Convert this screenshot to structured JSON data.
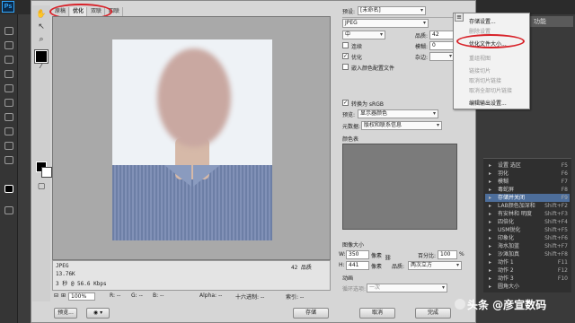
{
  "app": {
    "logo_text": "Ps",
    "panel_title": "功能"
  },
  "dialog": {
    "tabs": [
      "原稿",
      "优化",
      "双联",
      "四联"
    ],
    "active_tab": 1,
    "preset_label": "预设:",
    "preset_value": "[未命名]",
    "format_value": "JPEG",
    "compression_value": "中",
    "quality_label": "品质:",
    "quality_value": "42",
    "progressive_label": "连续",
    "blur_label": "模糊:",
    "blur_value": "0",
    "optimized_label": "优化",
    "matte_label": "杂边:",
    "embed_profile_label": "嵌入颜色配置文件",
    "convert_srgb_label": "转换为 sRGB",
    "preview_label": "预览:",
    "preview_value": "显示器颜色",
    "metadata_label": "元数据:",
    "metadata_value": "版权和联系信息",
    "color_table_label": "颜色表",
    "image_size_label": "图像大小",
    "width_label": "W:",
    "width_value": "350",
    "height_label": "H:",
    "height_value": "441",
    "unit_px": "像素",
    "percent_label": "百分比:",
    "percent_value": "100",
    "percent_unit": "%",
    "quality2_label": "品质:",
    "quality2_value": "两次立方",
    "animation_label": "动画",
    "loop_label": "循环选项:",
    "loop_value": "一次",
    "info_format": "JPEG",
    "info_size": "13.76K",
    "info_time": "3 秒 @ 56.6 Kbps",
    "info_quality": "42 品质",
    "zoom_value": "100%",
    "status_r": "R: --",
    "status_g": "G: --",
    "status_b": "B: --",
    "status_alpha": "Alpha: --",
    "status_hex": "十六进制: --",
    "status_index": "索引: --",
    "btn_preview": "预览...",
    "btn_save": "存储",
    "btn_cancel": "取消",
    "btn_done": "完成"
  },
  "menu": {
    "items": [
      {
        "label": "存储设置...",
        "enabled": true
      },
      {
        "label": "删除设置",
        "enabled": false
      },
      {
        "label": "优化文件大小...",
        "enabled": true
      },
      {
        "label": "重组视图",
        "enabled": false
      },
      {
        "label": "链接切片",
        "enabled": false
      },
      {
        "label": "取消切片链接",
        "enabled": false
      },
      {
        "label": "取消全部切片链接",
        "enabled": false
      },
      {
        "label": "编辑输出设置...",
        "enabled": true
      }
    ]
  },
  "actions_panel": {
    "items": [
      {
        "label": "设置 选区",
        "shortcut": "F5"
      },
      {
        "label": "羽化",
        "shortcut": "F6"
      },
      {
        "label": "模糊",
        "shortcut": "F7"
      },
      {
        "label": "毒蛇屏",
        "shortcut": "F8"
      },
      {
        "label": "存储并关闭",
        "shortcut": "F9"
      },
      {
        "label": "LAB颜色加深和",
        "shortcut": "Shift+F2"
      },
      {
        "label": "有安林和 明度",
        "shortcut": "Shift+F3"
      },
      {
        "label": "四倍化",
        "shortcut": "Shift+F4"
      },
      {
        "label": "USM锐化",
        "shortcut": "Shift+F5"
      },
      {
        "label": "印象化",
        "shortcut": "Shift+F6"
      },
      {
        "label": "海水加蓝",
        "shortcut": "Shift+F7"
      },
      {
        "label": "沙滩加真",
        "shortcut": "Shift+F8"
      },
      {
        "label": "动作 1",
        "shortcut": "F11"
      },
      {
        "label": "动作 2",
        "shortcut": "F12"
      },
      {
        "label": "动作 3",
        "shortcut": "F10"
      },
      {
        "label": "圆角大小",
        "shortcut": ""
      }
    ],
    "highlight_index": 4
  },
  "watermark": "头条 @彦宣数码",
  "colors": {
    "accent": "#d8232a",
    "ps_blue": "#31a8ff"
  }
}
